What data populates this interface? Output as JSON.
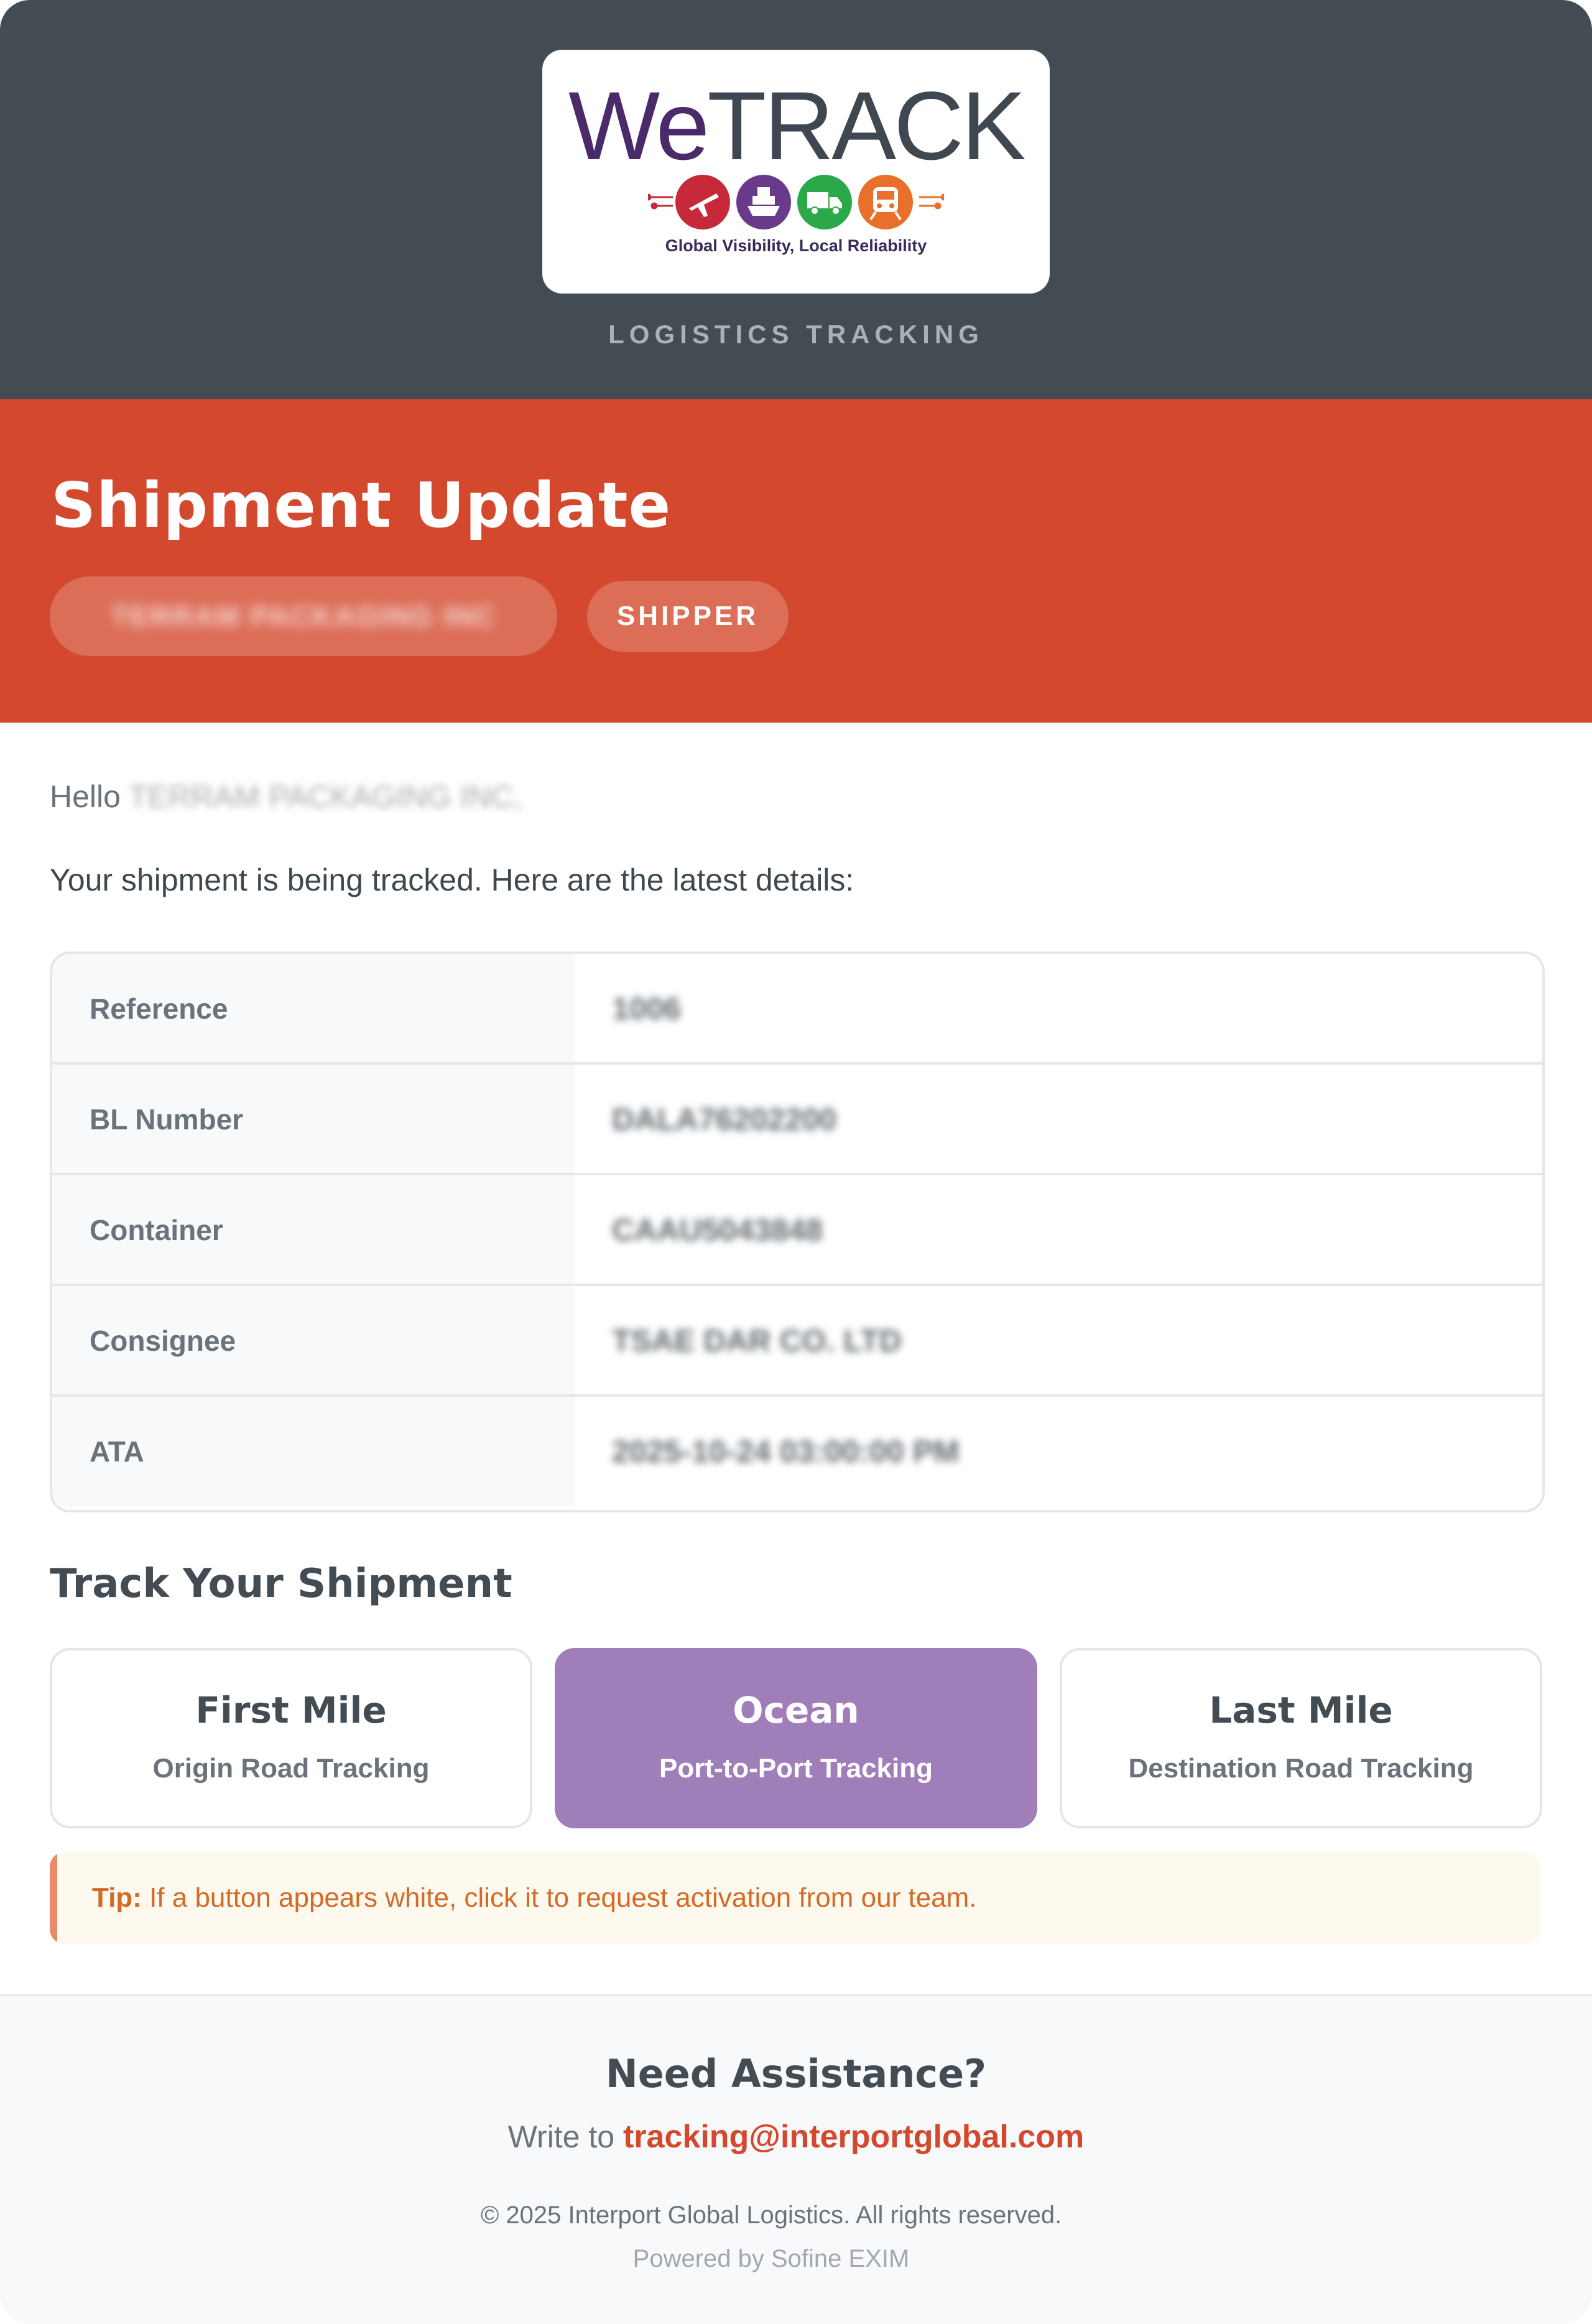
{
  "logo": {
    "we": "We",
    "track": "TRACK",
    "tagline": "Global Visibility, Local Reliability"
  },
  "header": {
    "label": "LOGISTICS TRACKING"
  },
  "banner": {
    "title": "Shipment Update",
    "company": "TERRAM PACKAGING INC",
    "role": "SHIPPER"
  },
  "greeting": {
    "hello": "Hello",
    "name": "TERRAM PACKAGING INC,"
  },
  "intro": "Your shipment is being tracked. Here are the latest details:",
  "details": [
    {
      "label": "Reference",
      "value": "1006"
    },
    {
      "label": "BL Number",
      "value": "DALA76202200"
    },
    {
      "label": "Container",
      "value": "CAAU5043848"
    },
    {
      "label": "Consignee",
      "value": "TSAE DAR CO. LTD"
    },
    {
      "label": "ATA",
      "value": "2025-10-24 03:00:00 PM"
    }
  ],
  "track": {
    "title": "Track Your Shipment",
    "buttons": [
      {
        "title": "First Mile",
        "subtitle": "Origin Road Tracking"
      },
      {
        "title": "Ocean",
        "subtitle": "Port-to-Port Tracking"
      },
      {
        "title": "Last Mile",
        "subtitle": "Destination Road Tracking"
      }
    ]
  },
  "tip": {
    "label": "Tip:",
    "text": "If a button appears white, click it to request activation from our team."
  },
  "footer": {
    "title": "Need Assistance?",
    "write_to": "Write to",
    "email": "tracking@interportglobal.com",
    "copyright": "© 2025 Interport Global Logistics. All rights reserved.",
    "powered": "Powered by Sofine EXIM"
  },
  "colors": {
    "header_bg": "#434c53",
    "banner_bg": "#d4492d",
    "ocean_active": "#a07eba",
    "icon_plane": "#c62a3a",
    "icon_ship": "#6a3a8a",
    "icon_truck": "#2aa84a",
    "icon_train": "#e8702a"
  }
}
